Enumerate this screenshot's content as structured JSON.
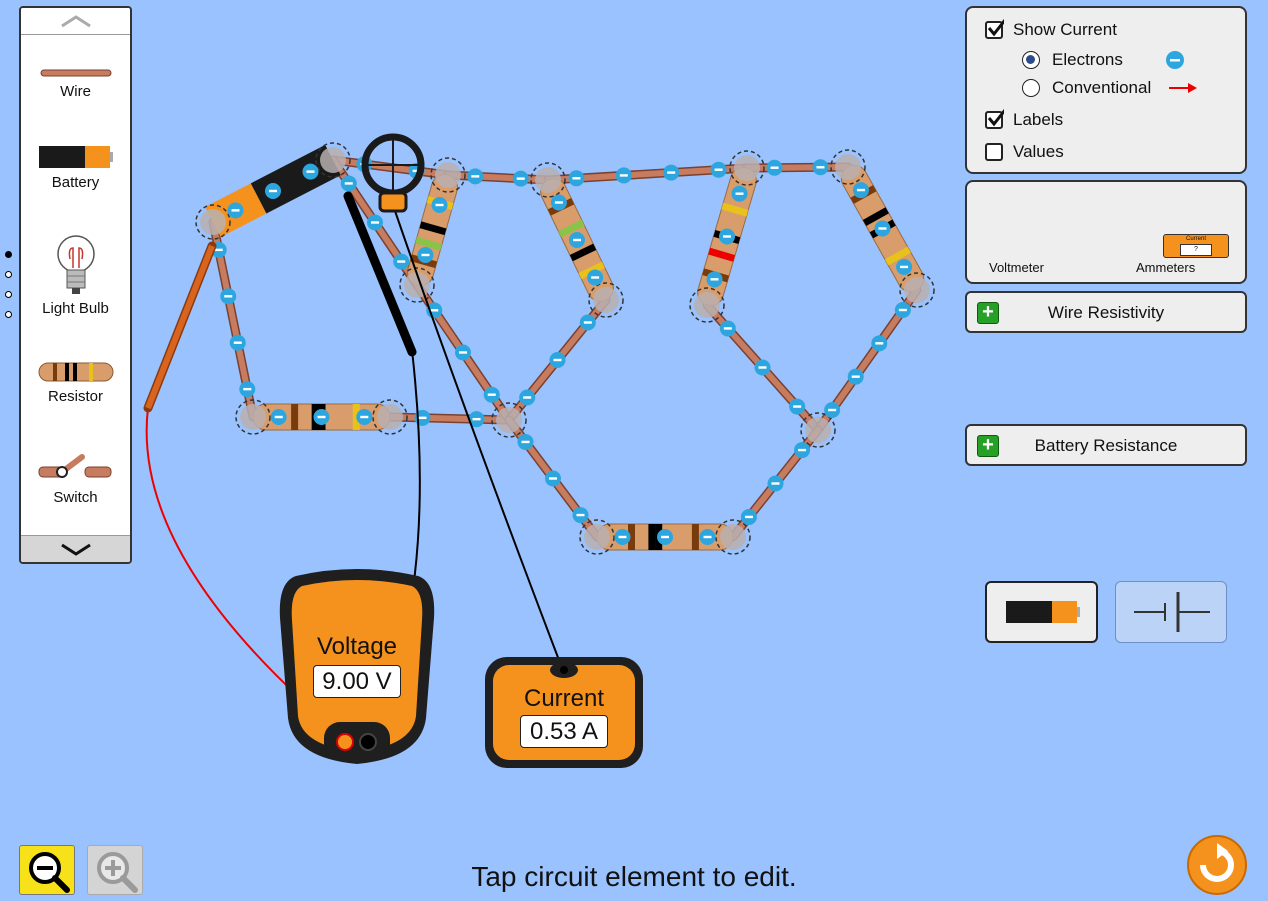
{
  "toolbox": {
    "items": [
      {
        "label": "Wire"
      },
      {
        "label": "Battery"
      },
      {
        "label": "Light Bulb"
      },
      {
        "label": "Resistor"
      },
      {
        "label": "Switch"
      }
    ]
  },
  "view_controls": {
    "show_current": {
      "label": "Show Current",
      "checked": true
    },
    "electrons": {
      "label": "Electrons",
      "selected": true
    },
    "conventional": {
      "label": "Conventional",
      "selected": false
    },
    "labels": {
      "label": "Labels",
      "checked": true
    },
    "values": {
      "label": "Values",
      "checked": false
    }
  },
  "sensor_toolbox": {
    "voltmeter_label": "Voltmeter",
    "ammeters_label": "Ammeters",
    "ammeter_icon_title": "Current",
    "ammeter_icon_value": "?"
  },
  "accordions": {
    "wire_resistivity": "Wire Resistivity",
    "battery_resistance": "Battery Resistance"
  },
  "voltmeter": {
    "title": "Voltage",
    "value": "9.00 V"
  },
  "ammeter": {
    "title": "Current",
    "value": "0.53 A"
  },
  "status_text": "Tap circuit element to edit.",
  "colors": {
    "background": "#99c2fe",
    "meter_orange": "#f5921e",
    "wire_copper": "#c77c60",
    "electron_blue": "#2da6e0"
  }
}
